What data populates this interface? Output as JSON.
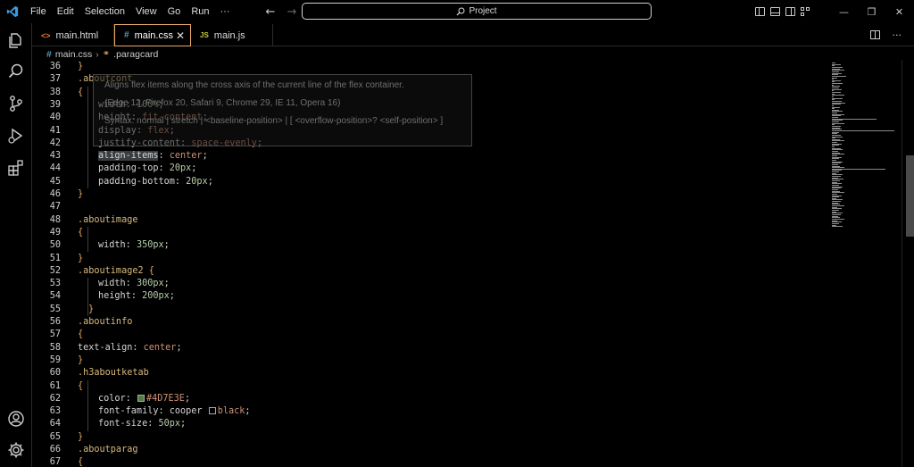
{
  "menu": [
    "File",
    "Edit",
    "Selection",
    "View",
    "Go",
    "Run",
    "···"
  ],
  "search": {
    "label": "Project"
  },
  "tabs": [
    {
      "label": "main.html",
      "icon": "html-file-icon",
      "glyph": "<>"
    },
    {
      "label": "main.css",
      "icon": "css-file-icon",
      "glyph": "#",
      "active": true
    },
    {
      "label": "main.js",
      "icon": "js-file-icon",
      "glyph": "JS"
    }
  ],
  "breadcrumb": {
    "file": "main.css",
    "symbol": ".paragcard"
  },
  "hover": {
    "line1": "Aligns flex items along the cross axis of the current line of the flex container.",
    "line2": "(Edge 12, Firefox 20, Safari 9, Chrome 29, IE 11, Opera 16)",
    "line3": "Syntax: normal | stretch | <baseline-position> | [ <overflow-position>? <self-position> ]"
  },
  "lines": [
    {
      "n": "36",
      "text": "}"
    },
    {
      "n": "37",
      "text": ".aboutcont"
    },
    {
      "n": "38",
      "text": "{"
    },
    {
      "n": "39",
      "text": "width: 100%;"
    },
    {
      "n": "40",
      "text": "height: fit-content;"
    },
    {
      "n": "41",
      "text": "display: flex;"
    },
    {
      "n": "42",
      "text": "justify-content: space-evenly;"
    },
    {
      "n": "43",
      "text": "align-items: center;"
    },
    {
      "n": "44",
      "text": "padding-top: 20px;"
    },
    {
      "n": "45",
      "text": "padding-bottom: 20px;"
    },
    {
      "n": "46",
      "text": "}"
    },
    {
      "n": "47",
      "text": ""
    },
    {
      "n": "48",
      "text": ".aboutimage"
    },
    {
      "n": "49",
      "text": "{"
    },
    {
      "n": "50",
      "text": "width: 350px;"
    },
    {
      "n": "51",
      "text": "}"
    },
    {
      "n": "52",
      "text": ".aboutimage2 {"
    },
    {
      "n": "53",
      "text": "width: 300px;"
    },
    {
      "n": "54",
      "text": "height: 200px;"
    },
    {
      "n": "55",
      "text": "}"
    },
    {
      "n": "56",
      "text": ".aboutinfo"
    },
    {
      "n": "57",
      "text": "{"
    },
    {
      "n": "58",
      "text": "text-align: center;"
    },
    {
      "n": "59",
      "text": "}"
    },
    {
      "n": "60",
      "text": ".h3aboutketab"
    },
    {
      "n": "61",
      "text": "{"
    },
    {
      "n": "62",
      "text": "color: #4D7E3E;"
    },
    {
      "n": "63",
      "text": "font-family: cooper black;"
    },
    {
      "n": "64",
      "text": "font-size: 50px;"
    },
    {
      "n": "65",
      "text": "}"
    },
    {
      "n": "66",
      "text": ".aboutparag"
    },
    {
      "n": "67",
      "text": "{"
    }
  ],
  "colors": {
    "accent_tab": "#e8a864",
    "swatch_green": "#4D7E3E",
    "swatch_black": "#000000"
  }
}
